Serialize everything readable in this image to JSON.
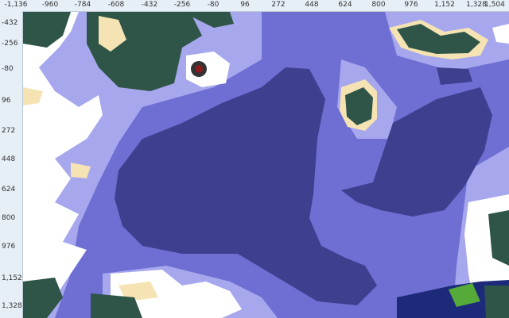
{
  "ruler": {
    "x_ticks": [
      "-1,136",
      "-960",
      "-784",
      "-608",
      "-432",
      "-256",
      "-80",
      "96",
      "272",
      "448",
      "624",
      "800",
      "976",
      "1,152",
      "1,328",
      "1,504"
    ],
    "y_ticks": [
      "-432",
      "-256",
      "-80",
      "96",
      "272",
      "448",
      "624",
      "800",
      "976",
      "1,152",
      "1,328"
    ]
  },
  "colors": {
    "deep_ocean": "#3f3f8f",
    "ocean": "#6e6ed3",
    "shallow": "#a7a7ee",
    "snow": "#ffffff",
    "forest": "#2f5548",
    "sand": "#f5e3b3",
    "grass": "#55aa3a",
    "deep_dark": "#1d2a7a"
  },
  "markers": [
    {
      "name": "player-marker",
      "icon": "player-marker-icon"
    }
  ]
}
